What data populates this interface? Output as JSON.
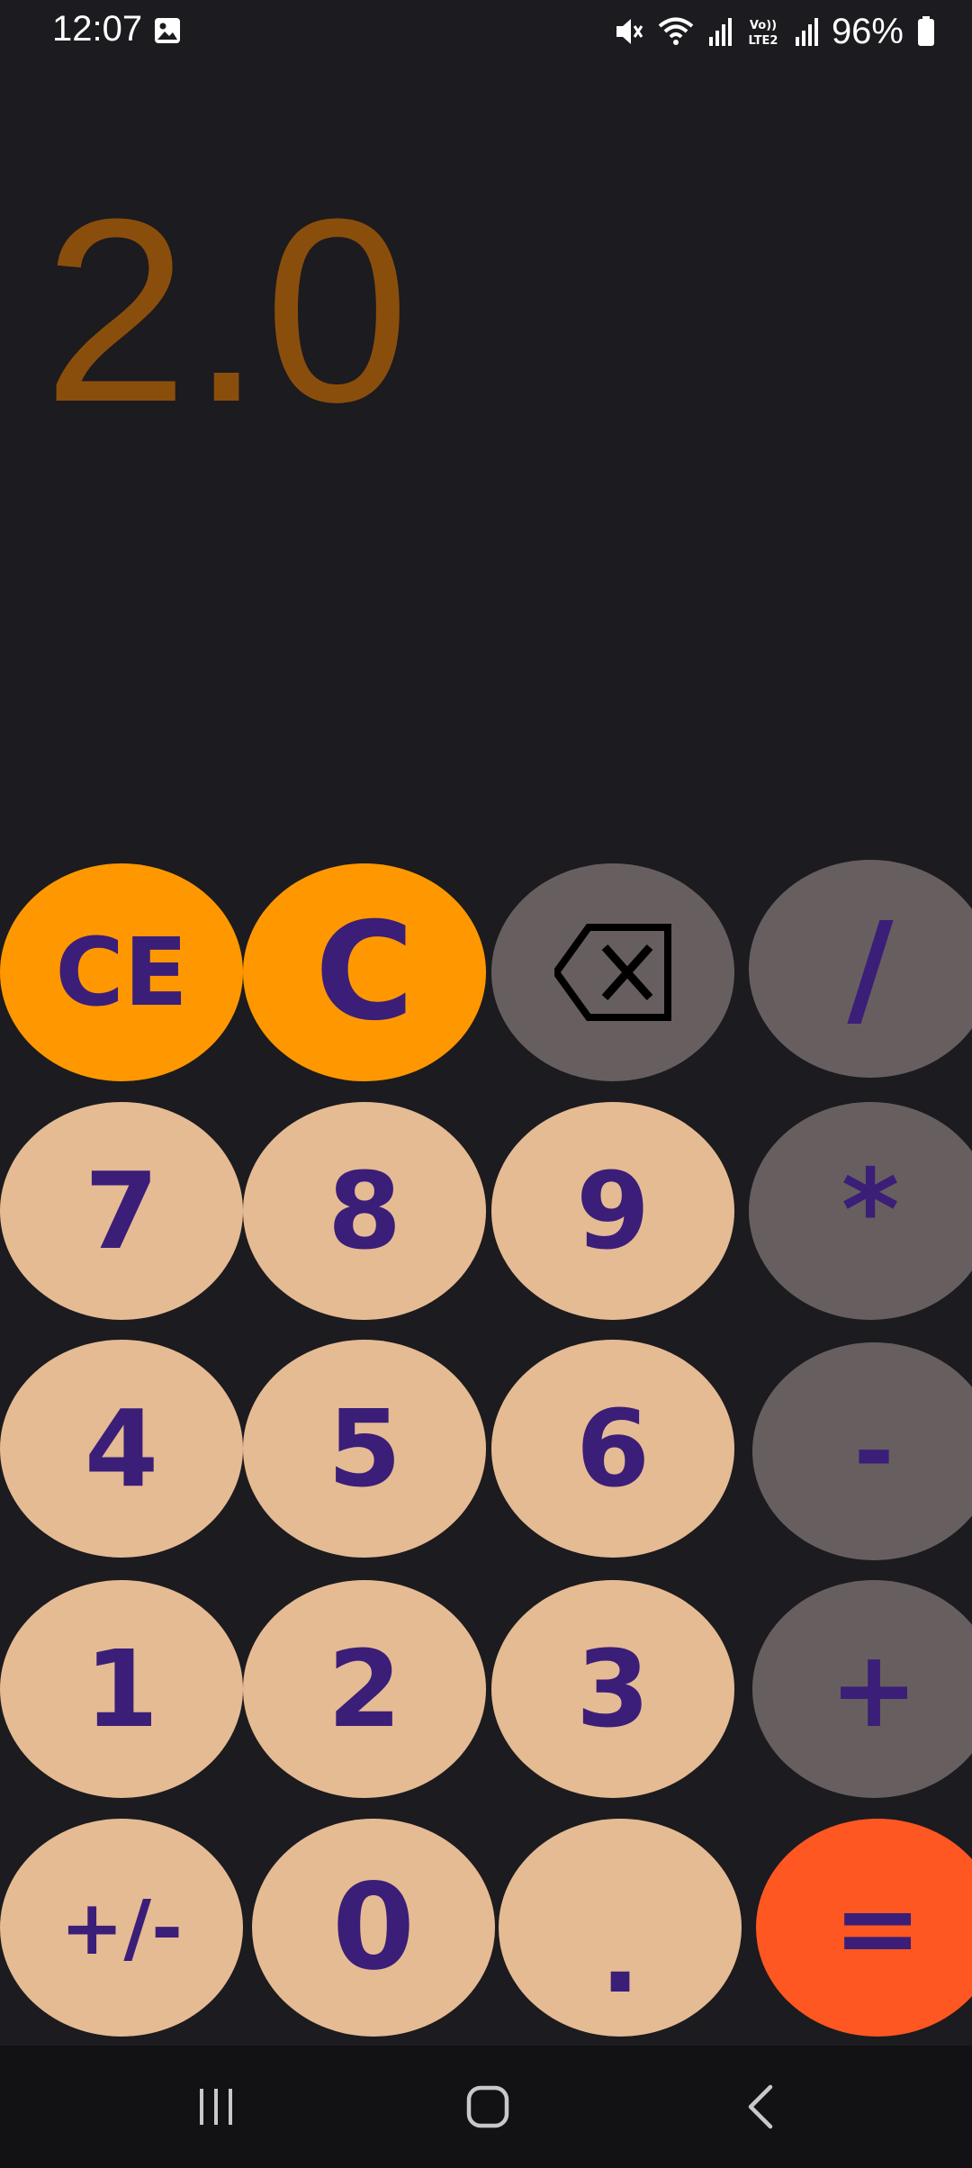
{
  "status_bar": {
    "time": "12:07",
    "battery_percent": "96%",
    "icons": [
      "gallery-icon",
      "mute-icon",
      "wifi-icon",
      "signal-icon",
      "volte-lte2-icon",
      "signal-icon-2",
      "battery-icon"
    ]
  },
  "display": {
    "value": "2.0",
    "color": "#8a4e0c"
  },
  "keypad": {
    "row1": [
      "CE",
      "C",
      "backspace",
      "/"
    ],
    "row2": [
      "7",
      "8",
      "9",
      "*"
    ],
    "row3": [
      "4",
      "5",
      "6",
      "-"
    ],
    "row4": [
      "1",
      "2",
      "3",
      "+"
    ],
    "row5": [
      "+/-",
      "0",
      ".",
      "="
    ],
    "labels": {
      "ce": "CE",
      "c": "C",
      "divide": "/",
      "seven": "7",
      "eight": "8",
      "nine": "9",
      "multiply": "*",
      "four": "4",
      "five": "5",
      "six": "6",
      "minus": "-",
      "one": "1",
      "two": "2",
      "three": "3",
      "plus": "+",
      "negate": "+/-",
      "zero": "0",
      "decimal": ".",
      "equals": "="
    }
  },
  "colors": {
    "background": "#1c1b1f",
    "clear_keys": "#ff9800",
    "operator_keys": "#675f5f",
    "digit_keys": "#e5bb94",
    "equals_key": "#ff5722",
    "key_text": "#3b1e78"
  },
  "nav_bar": {
    "icons": [
      "recents-icon",
      "home-icon",
      "back-icon"
    ]
  }
}
